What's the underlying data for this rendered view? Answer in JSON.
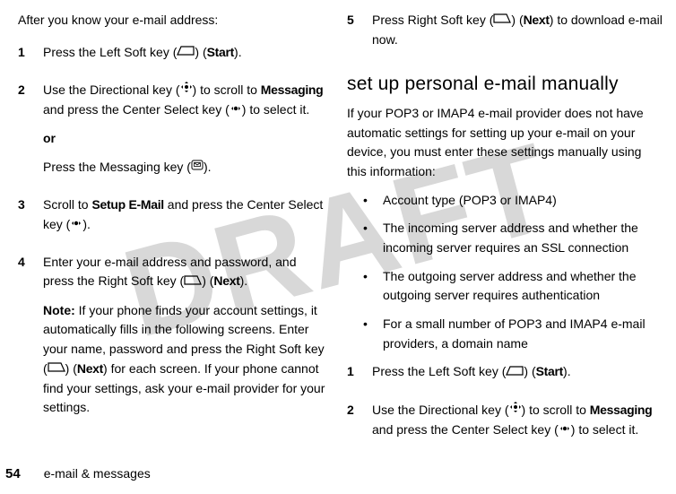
{
  "watermark": "DRAFT",
  "leftColumn": {
    "lead": "After you know your e-mail address:",
    "step1": {
      "num": "1",
      "pre": "Press the Left Soft key (",
      "post": ") (",
      "label": "Start",
      "end": ")."
    },
    "step2": {
      "num": "2",
      "t1": "Use the Directional key (",
      "t2": ") to scroll to ",
      "msg": "Messaging",
      "t3": " and press the Center Select key (",
      "t4": ") to select it.",
      "or": "or",
      "t5": "Press the Messaging key (",
      "t6": ")."
    },
    "step3": {
      "num": "3",
      "t1": "Scroll to ",
      "label": "Setup E-Mail",
      "t2": " and press the Center Select key (",
      "t3": ")."
    },
    "step4": {
      "num": "4",
      "t1": "Enter your e-mail address and password, and press the Right Soft key (",
      "t2": ") (",
      "label": "Next",
      "t3": ").",
      "noteLabel": "Note:",
      "note1": " If your phone finds your account settings, it automatically fills in the following screens. Enter your name, password and press the Right Soft key (",
      "note2": ") (",
      "noteNext": "Next",
      "note3": ") for each screen. If your phone cannot find your settings, ask your e-mail provider for your settings."
    }
  },
  "rightColumn": {
    "step5": {
      "num": "5",
      "t1": "Press Right Soft key (",
      "t2": ") (",
      "label": "Next",
      "t3": ") to download e-mail now."
    },
    "heading": "set up personal e-mail manually",
    "para": "If your POP3 or IMAP4 e-mail provider does not have automatic settings for setting up your e-mail on your device, you must enter these settings manually using this information:",
    "bullets": [
      "Account type (POP3 or IMAP4)",
      "The incoming server address and whether the incoming server requires an SSL connection",
      "The outgoing server address and whether the outgoing server requires authentication",
      "For a small number of POP3 and IMAP4 e-mail providers, a domain name"
    ],
    "step1": {
      "num": "1",
      "pre": "Press the Left Soft key (",
      "post": ") (",
      "label": "Start",
      "end": ")."
    },
    "step2": {
      "num": "2",
      "t1": "Use the Directional key (",
      "t2": ") to scroll to ",
      "msg": "Messaging",
      "t3": " and press the Center Select key (",
      "t4": ") to select it."
    }
  },
  "footer": {
    "page": "54",
    "text": "e-mail & messages"
  }
}
